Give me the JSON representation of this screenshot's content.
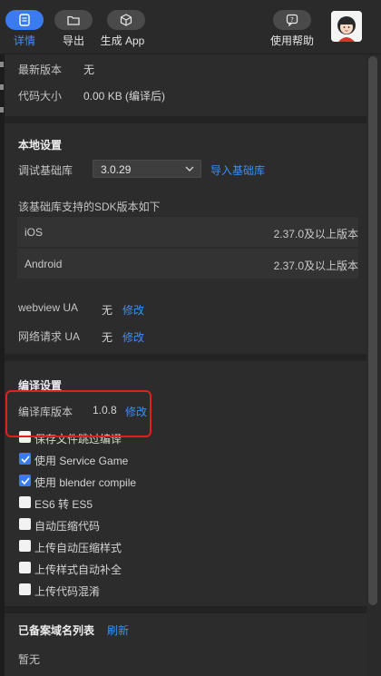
{
  "toolbar": {
    "details": "详情",
    "export": "导出",
    "build_app": "生成 App",
    "help": "使用帮助"
  },
  "basic_info": {
    "latest_version_label": "最新版本",
    "latest_version_value": "无",
    "code_size_label": "代码大小",
    "code_size_value": "0.00 KB (编译后)"
  },
  "local_settings": {
    "title": "本地设置",
    "debug_lib_label": "调试基础库",
    "debug_lib_value": "3.0.29",
    "import_lib": "导入基础库",
    "sdk_support_text": "该基础库支持的SDK版本如下",
    "sdk_rows": [
      {
        "name": "iOS",
        "version": "2.37.0及以上版本"
      },
      {
        "name": "Android",
        "version": "2.37.0及以上版本"
      }
    ],
    "webview_ua_label": "webview UA",
    "webview_ua_value": "无",
    "webview_ua_edit": "修改",
    "network_ua_label": "网络请求 UA",
    "network_ua_value": "无",
    "network_ua_edit": "修改"
  },
  "compile_settings": {
    "title": "编译设置",
    "compiler_version_label": "编译库版本",
    "compiler_version_value": "1.0.8",
    "compiler_version_edit": "修改",
    "options": [
      {
        "label": "保存文件跳过编译",
        "checked": false
      },
      {
        "label": "使用 Service Game",
        "checked": true
      },
      {
        "label": "使用 blender compile",
        "checked": true
      },
      {
        "label": "ES6 转 ES5",
        "checked": false
      },
      {
        "label": "自动压缩代码",
        "checked": false
      },
      {
        "label": "上传自动压缩样式",
        "checked": false
      },
      {
        "label": "上传样式自动补全",
        "checked": false
      },
      {
        "label": "上传代码混淆",
        "checked": false
      }
    ]
  },
  "domains": {
    "title": "已备案域名列表",
    "refresh": "刷新",
    "empty_text": "暂无"
  },
  "colors": {
    "accent": "#3a7cf0",
    "link": "#3b8ff2",
    "highlight": "#e0201c",
    "background": "#2c2c2c"
  }
}
